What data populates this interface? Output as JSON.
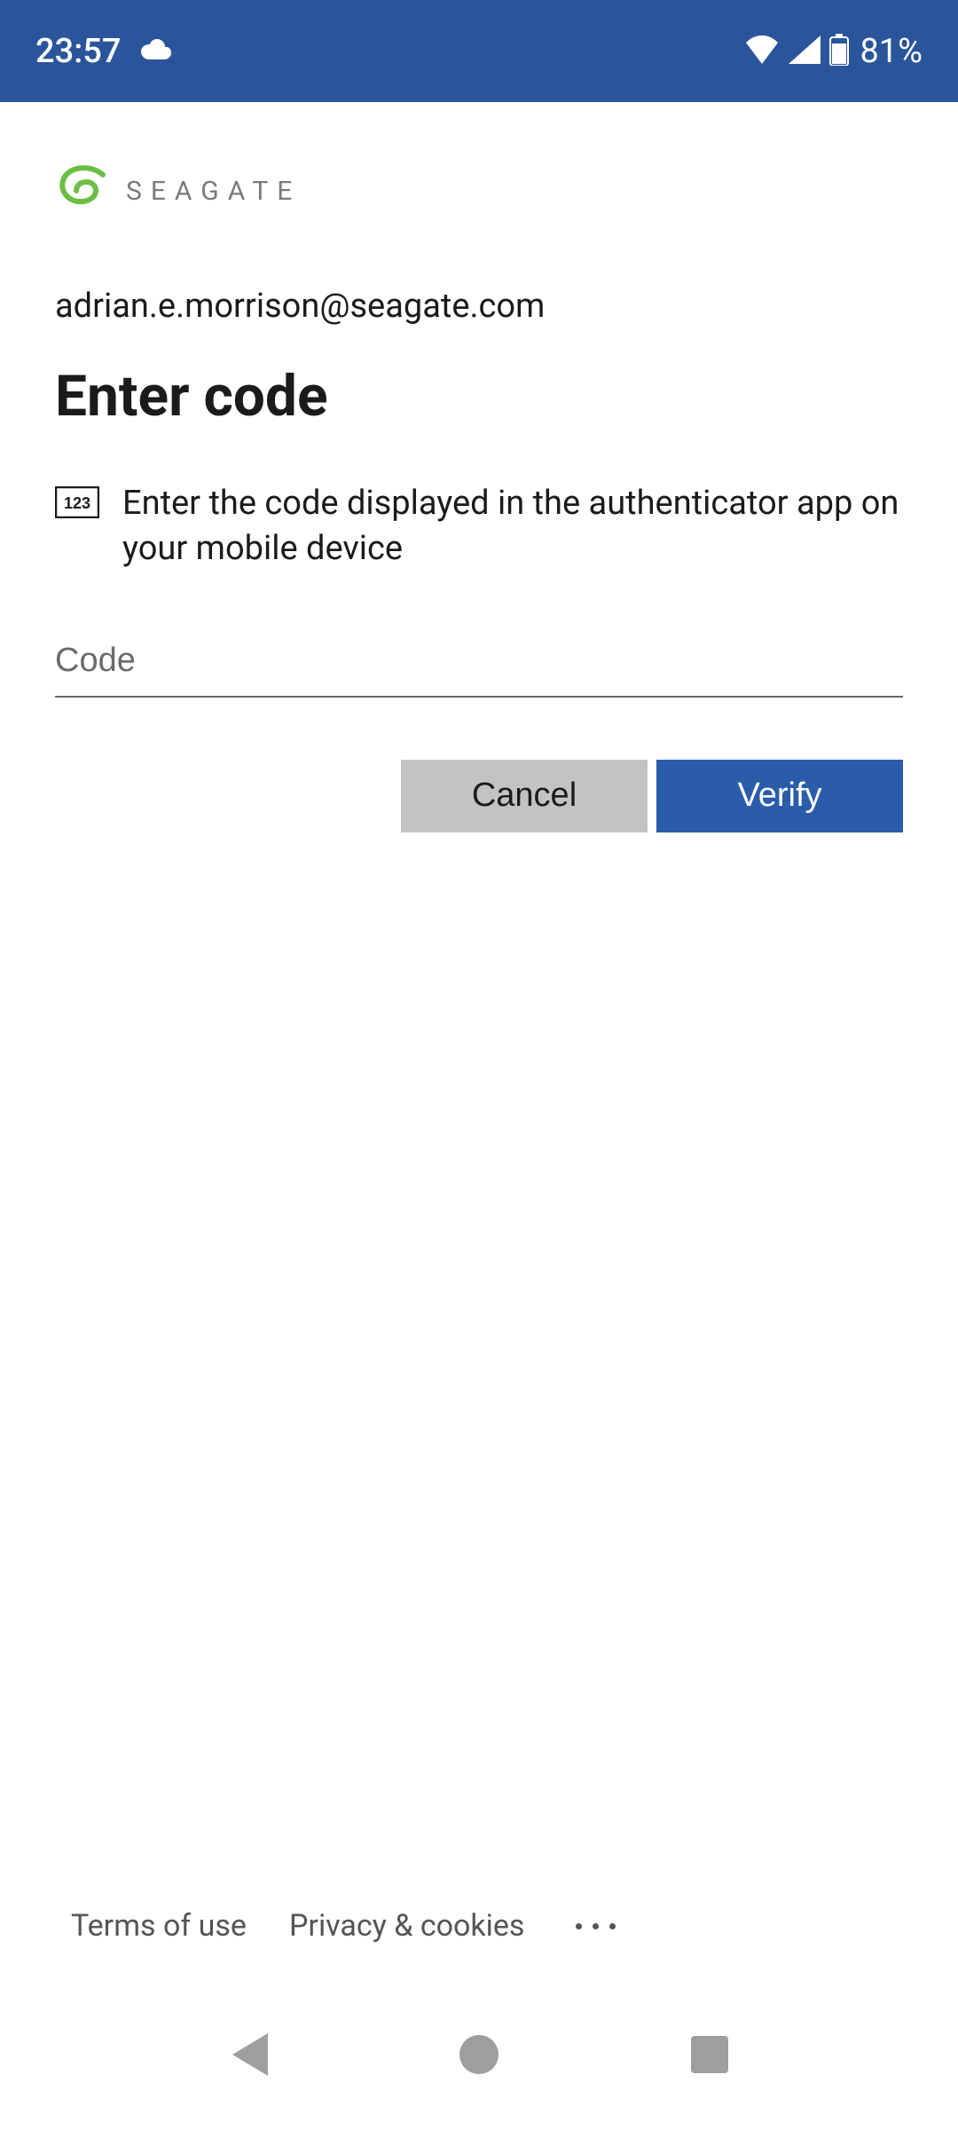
{
  "status": {
    "time": "23:57",
    "battery_text": "81%"
  },
  "brand": {
    "name": "SEAGATE"
  },
  "auth": {
    "email": "adrian.e.morrison@seagate.com",
    "heading": "Enter code",
    "instruction": "Enter the code displayed in the authenticator app on your mobile device",
    "code_value": "",
    "code_placeholder": "Code",
    "cancel_label": "Cancel",
    "verify_label": "Verify"
  },
  "footer": {
    "terms": "Terms of use",
    "privacy": "Privacy & cookies"
  }
}
